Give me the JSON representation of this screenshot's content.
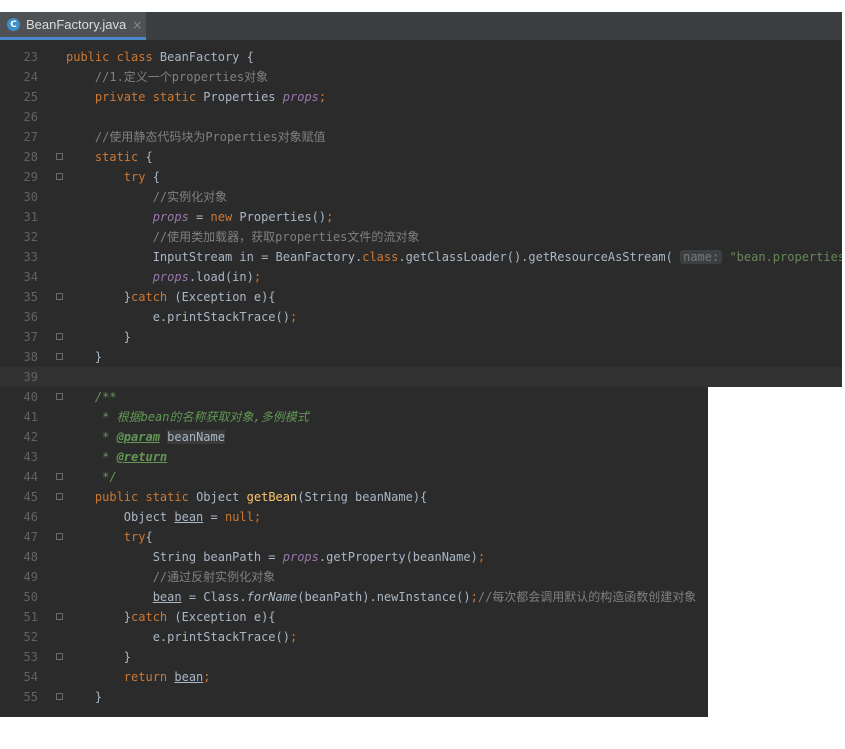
{
  "tab": {
    "filename": "BeanFactory.java",
    "icon": "C",
    "close": "×"
  },
  "colors": {
    "background": "#2b2b2b",
    "keyword": "#cc7832",
    "comment": "#808080",
    "field": "#9876aa",
    "string": "#6a8759",
    "method": "#ffc66d",
    "doc": "#629755"
  },
  "lines": [
    {
      "n": "23",
      "parts": [
        [
          "kw",
          "public class "
        ],
        [
          "",
          "BeanFactory {"
        ]
      ]
    },
    {
      "n": "24",
      "parts": [
        [
          "",
          "    "
        ],
        [
          "cm",
          "//1.定义一个properties对象"
        ]
      ]
    },
    {
      "n": "25",
      "parts": [
        [
          "",
          "    "
        ],
        [
          "kw",
          "private static "
        ],
        [
          "",
          "Properties "
        ],
        [
          "fld",
          "props"
        ],
        [
          "kw",
          ";"
        ]
      ]
    },
    {
      "n": "26",
      "parts": []
    },
    {
      "n": "27",
      "parts": [
        [
          "",
          "    "
        ],
        [
          "cm",
          "//使用静态代码块为Properties对象赋值"
        ]
      ]
    },
    {
      "n": "28",
      "parts": [
        [
          "",
          "    "
        ],
        [
          "kw",
          "static "
        ],
        [
          "",
          "{"
        ]
      ]
    },
    {
      "n": "29",
      "parts": [
        [
          "",
          "        "
        ],
        [
          "kw",
          "try "
        ],
        [
          "",
          "{"
        ]
      ]
    },
    {
      "n": "30",
      "parts": [
        [
          "",
          "            "
        ],
        [
          "cm",
          "//实例化对象"
        ]
      ]
    },
    {
      "n": "31",
      "parts": [
        [
          "",
          "            "
        ],
        [
          "fld",
          "props"
        ],
        [
          "",
          " = "
        ],
        [
          "kw",
          "new "
        ],
        [
          "",
          "Properties()"
        ],
        [
          "kw",
          ";"
        ]
      ]
    },
    {
      "n": "32",
      "parts": [
        [
          "",
          "            "
        ],
        [
          "cm",
          "//使用类加载器，获取properties文件的流对象"
        ]
      ]
    },
    {
      "n": "33",
      "parts": [
        [
          "",
          "            InputStream in = BeanFactory."
        ],
        [
          "kw",
          "class"
        ],
        [
          "",
          ".getClassLoader().getResourceAsStream( "
        ],
        [
          "hint",
          "name:"
        ],
        [
          "str",
          " \"bean.properties\""
        ],
        [
          "",
          ")"
        ],
        [
          "kw",
          ";"
        ]
      ]
    },
    {
      "n": "34",
      "parts": [
        [
          "",
          "            "
        ],
        [
          "fld",
          "props"
        ],
        [
          "",
          ".load(in)"
        ],
        [
          "kw",
          ";"
        ]
      ]
    },
    {
      "n": "35",
      "parts": [
        [
          "",
          "        }"
        ],
        [
          "kw",
          "catch "
        ],
        [
          "",
          "(Exception e){"
        ]
      ]
    },
    {
      "n": "36",
      "parts": [
        [
          "",
          "            e.printStackTrace()"
        ],
        [
          "kw",
          ";"
        ]
      ]
    },
    {
      "n": "37",
      "parts": [
        [
          "",
          "        }"
        ]
      ]
    },
    {
      "n": "38",
      "parts": [
        [
          "",
          "    }"
        ]
      ]
    },
    {
      "n": "39",
      "parts": []
    },
    {
      "n": "40",
      "parts": [
        [
          "",
          "    "
        ],
        [
          "doc",
          "/**"
        ]
      ]
    },
    {
      "n": "41",
      "parts": [
        [
          "",
          "     "
        ],
        [
          "doc",
          "* 根据bean的名称获取对象,多例模式"
        ]
      ]
    },
    {
      "n": "42",
      "parts": [
        [
          "",
          "     "
        ],
        [
          "doc",
          "* "
        ],
        [
          "tag",
          "@param"
        ],
        [
          "doc",
          " "
        ],
        [
          "docparam",
          "beanName"
        ]
      ]
    },
    {
      "n": "43",
      "parts": [
        [
          "",
          "     "
        ],
        [
          "doc",
          "* "
        ],
        [
          "tag",
          "@return"
        ]
      ]
    },
    {
      "n": "44",
      "parts": [
        [
          "",
          "     "
        ],
        [
          "doc",
          "*/"
        ]
      ]
    },
    {
      "n": "45",
      "parts": [
        [
          "",
          "    "
        ],
        [
          "kw",
          "public static "
        ],
        [
          "",
          "Object "
        ],
        [
          "fn",
          "getBean"
        ],
        [
          "",
          "(String beanName){"
        ]
      ]
    },
    {
      "n": "46",
      "parts": [
        [
          "",
          "        Object "
        ],
        [
          "ul",
          "bean"
        ],
        [
          "",
          " = "
        ],
        [
          "kw",
          "null;"
        ]
      ]
    },
    {
      "n": "47",
      "parts": [
        [
          "",
          "        "
        ],
        [
          "kw",
          "try"
        ],
        [
          "",
          "{"
        ]
      ]
    },
    {
      "n": "48",
      "parts": [
        [
          "",
          "            String beanPath = "
        ],
        [
          "fld",
          "props"
        ],
        [
          "",
          ".getProperty(beanName)"
        ],
        [
          "kw",
          ";"
        ]
      ]
    },
    {
      "n": "49",
      "parts": [
        [
          "",
          "            "
        ],
        [
          "cm",
          "//通过反射实例化对象"
        ]
      ]
    },
    {
      "n": "50",
      "parts": [
        [
          "",
          "            "
        ],
        [
          "ul",
          "bean"
        ],
        [
          "",
          " = Class."
        ],
        [
          "it",
          "forName"
        ],
        [
          "",
          "(beanPath).newInstance()"
        ],
        [
          "kw",
          ";"
        ],
        [
          "cm",
          "//每次都会调用默认的构造函数创建对象"
        ]
      ]
    },
    {
      "n": "51",
      "parts": [
        [
          "",
          "        }"
        ],
        [
          "kw",
          "catch "
        ],
        [
          "",
          "(Exception e){"
        ]
      ]
    },
    {
      "n": "52",
      "parts": [
        [
          "",
          "            e.printStackTrace()"
        ],
        [
          "kw",
          ";"
        ]
      ]
    },
    {
      "n": "53",
      "parts": [
        [
          "",
          "        }"
        ]
      ]
    },
    {
      "n": "54",
      "parts": [
        [
          "",
          "        "
        ],
        [
          "kw",
          "return "
        ],
        [
          "ul",
          "bean"
        ],
        [
          "kw",
          ";"
        ]
      ]
    },
    {
      "n": "55",
      "parts": [
        [
          "",
          "    }"
        ]
      ]
    }
  ]
}
